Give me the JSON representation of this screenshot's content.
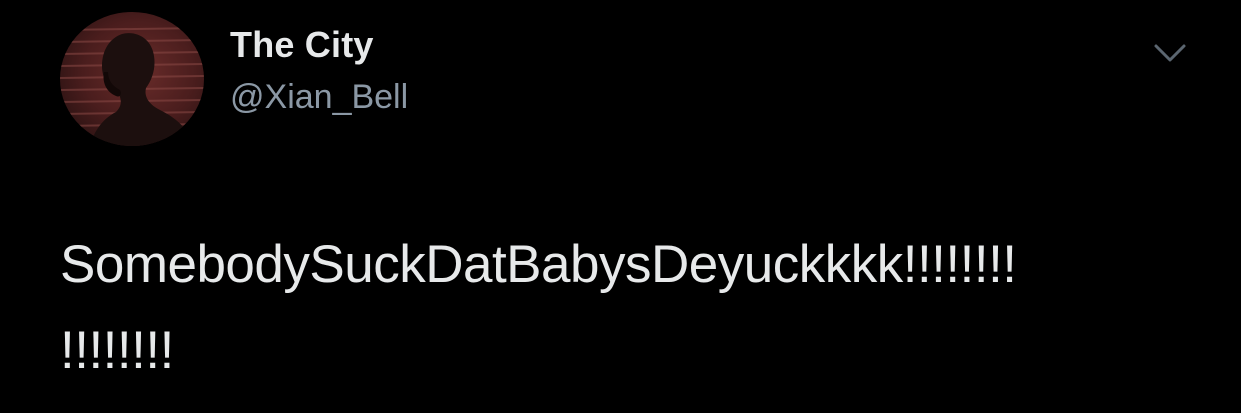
{
  "tweet": {
    "author": {
      "display_name": "The City",
      "handle": "@Xian_Bell",
      "avatar_icon": "profile-photo"
    },
    "menu_icon": "chevron-down-icon",
    "text_lines": [
      "SomebodySuckDatBabysDeyuckkkk!!!!!!!!",
      "!!!!!!!!"
    ]
  },
  "colors": {
    "background": "#000000",
    "name": "#e7e9ea",
    "handle": "#8b98a5",
    "chevron": "#5b6670"
  }
}
